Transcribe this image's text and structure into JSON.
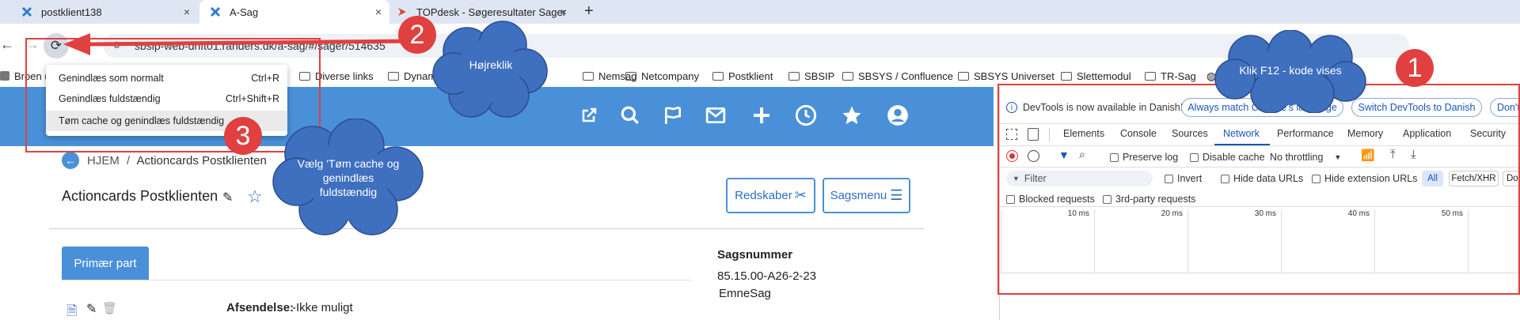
{
  "tabs": [
    {
      "title": "postklient138",
      "close": "×"
    },
    {
      "title": "A-Sag",
      "close": "×"
    },
    {
      "title": "TOPdesk - Søgeresultater Sager",
      "close": "×"
    }
  ],
  "new_tab": "+",
  "nav": {
    "back": "←",
    "forward": "→",
    "reload": "⟳"
  },
  "url": "sbsip-web-drift01.randers.dk/a-sag/#/sager/514635",
  "bookmarks": [
    "Broen (I",
    "Diverse links",
    "Dynam",
    "Nemsag",
    "Netcompany",
    "Postklient",
    "SBSIP",
    "SBSYS / Confluence",
    "SBSYS Universet",
    "Slettemodul",
    "TR-Sag"
  ],
  "context_menu": [
    {
      "label": "Genindlæs som normalt",
      "shortcut": "Ctrl+R"
    },
    {
      "label": "Genindlæs fuldstændig",
      "shortcut": "Ctrl+Shift+R"
    },
    {
      "label": "Tøm cache og genindlæs fuldstændig",
      "shortcut": ""
    }
  ],
  "app": {
    "breadcrumb_home": "HJEM",
    "breadcrumb_sep": "/",
    "breadcrumb_current": "Actioncards Postklienten",
    "title": "Actioncards Postklienten",
    "btn_tools": "Redskaber",
    "btn_menu": "Sagsmenu",
    "tab_primary": "Primær part",
    "sagsnummer_label": "Sagsnummer",
    "sagsnummer_value": "85.15.00-A26-2-23",
    "emnesag": "EmneSag",
    "afsendelse_label": "Afsendelse:",
    "afsendelse_value": "-Ikke muligt"
  },
  "devtools": {
    "info": "DevTools is now available in Danish!",
    "btn_match": "Always match Chrome's language",
    "btn_switch": "Switch DevTools to Danish",
    "btn_dont": "Don't",
    "tabs": [
      "Elements",
      "Console",
      "Sources",
      "Network",
      "Performance",
      "Memory",
      "Application",
      "Security"
    ],
    "active_tab": "Network",
    "preserve_log": "Preserve log",
    "disable_cache": "Disable cache",
    "throttling": "No throttling",
    "filter_placeholder": "Filter",
    "invert": "Invert",
    "hide_data_urls": "Hide data URLs",
    "hide_ext_urls": "Hide extension URLs",
    "all": "All",
    "fetch_xhr": "Fetch/XHR",
    "doc": "Doc",
    "blocked_requests": "Blocked requests",
    "third_party": "3rd-party requests",
    "timeline": [
      "10 ms",
      "20 ms",
      "30 ms",
      "40 ms",
      "50 ms"
    ]
  },
  "annotations": {
    "num1": "1",
    "num2": "2",
    "num3": "3",
    "cloud_f12": "Klik F12 - kode vises",
    "cloud_right": "Højreklik",
    "cloud_select": "Vælg 'Tøm cache og genindlæs fuldstændig"
  },
  "colors": {
    "app_blue": "#4a90d9",
    "annotation_red": "#e04040",
    "cloud_blue": "#3f6fbf"
  }
}
